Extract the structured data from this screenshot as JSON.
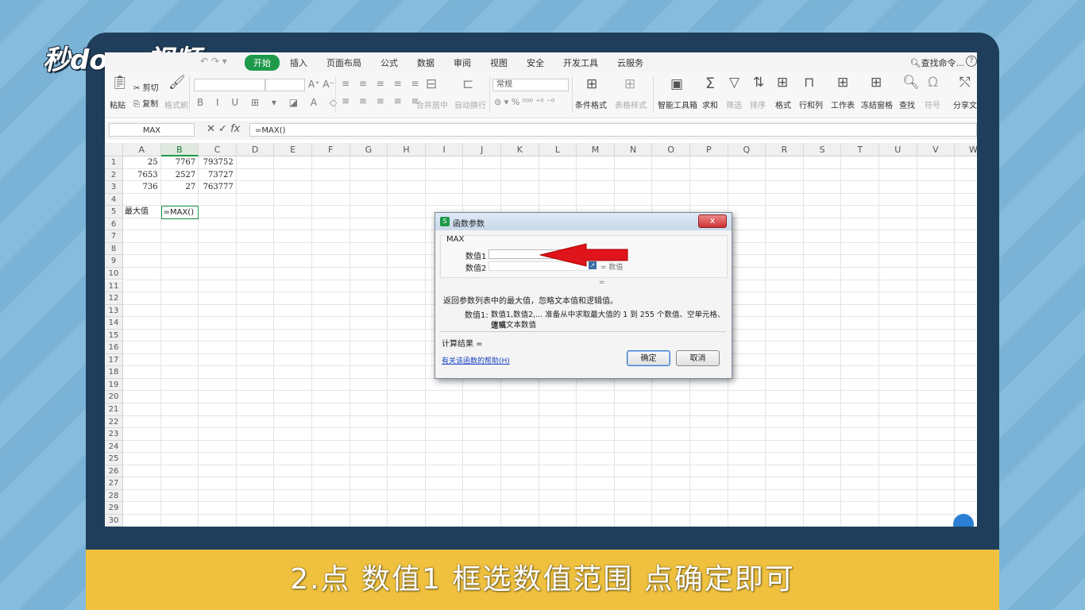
{
  "logo_text": "秒dong视频",
  "caption": "2.点 数值1 框选数值范围 点确定即可",
  "menubar": {
    "tabs": [
      {
        "label": "开始",
        "active": true
      },
      {
        "label": "插入"
      },
      {
        "label": "页面布局"
      },
      {
        "label": "公式"
      },
      {
        "label": "数据"
      },
      {
        "label": "审阅"
      },
      {
        "label": "视图"
      },
      {
        "label": "安全"
      },
      {
        "label": "开发工具"
      },
      {
        "label": "云服务"
      }
    ],
    "search_label": "查找命令...",
    "help": "?"
  },
  "ribbon": {
    "cut": "剪切",
    "copy": "复制",
    "paste": "粘贴",
    "format_painter": "格式刷",
    "merge_center": "合并居中",
    "wrap": "自动换行",
    "number_format": "常规",
    "cond_format": "条件格式",
    "table_style": "表格样式",
    "smart_toolbox": "智能工具箱",
    "sum": "求和",
    "filter": "筛选",
    "sort": "排序",
    "format": "格式",
    "row_col": "行和列",
    "worksheet": "工作表",
    "freeze": "冻结窗格",
    "find": "查找",
    "symbol": "符号",
    "share": "分享文"
  },
  "formula_bar": {
    "name_box": "MAX",
    "formula": "=MAX()"
  },
  "columns": [
    "A",
    "B",
    "C",
    "D",
    "E",
    "F",
    "G",
    "H",
    "I",
    "J",
    "K",
    "L",
    "M",
    "N",
    "O",
    "P",
    "Q",
    "R",
    "S",
    "T",
    "U",
    "V",
    "W"
  ],
  "rows": [
    "1",
    "2",
    "3",
    "4",
    "5",
    "6",
    "7",
    "8",
    "9",
    "10",
    "11",
    "12",
    "13",
    "14",
    "15",
    "16",
    "17",
    "18",
    "19",
    "20",
    "21",
    "22",
    "23",
    "24",
    "25",
    "26",
    "27",
    "28",
    "29",
    "30"
  ],
  "cells": {
    "A1": "25",
    "B1": "7767",
    "C1": "793752",
    "A2": "7653",
    "B2": "2527",
    "C2": "73727",
    "A3": "736",
    "B3": "27",
    "C3": "763777",
    "A5": "最大值",
    "B5": "=MAX()"
  },
  "dialog": {
    "title": "函数参数",
    "function_name": "MAX",
    "arg1_label": "数值1",
    "arg2_label": "数值2",
    "arg2_result": "= 数值",
    "result_eq": "=",
    "description": "返回参数列表中的最大值，忽略文本值和逻辑值。",
    "arg_help_label": "数值1:",
    "arg_help_text1": "数值1,数值2,... 准备从中求取最大值的 1 到 255 个数值、空单元格、逻辑",
    "arg_help_text2": "值或文本数值",
    "calc_result": "计算结果 =",
    "help_link": "有关该函数的帮助(H)",
    "ok": "确定",
    "cancel": "取消",
    "close": "x"
  },
  "colors": {
    "accent": "#1e9a4a",
    "arrow": "#e0141b",
    "caption_bg": "#f0c13e",
    "monitor": "#1f3e5c"
  }
}
